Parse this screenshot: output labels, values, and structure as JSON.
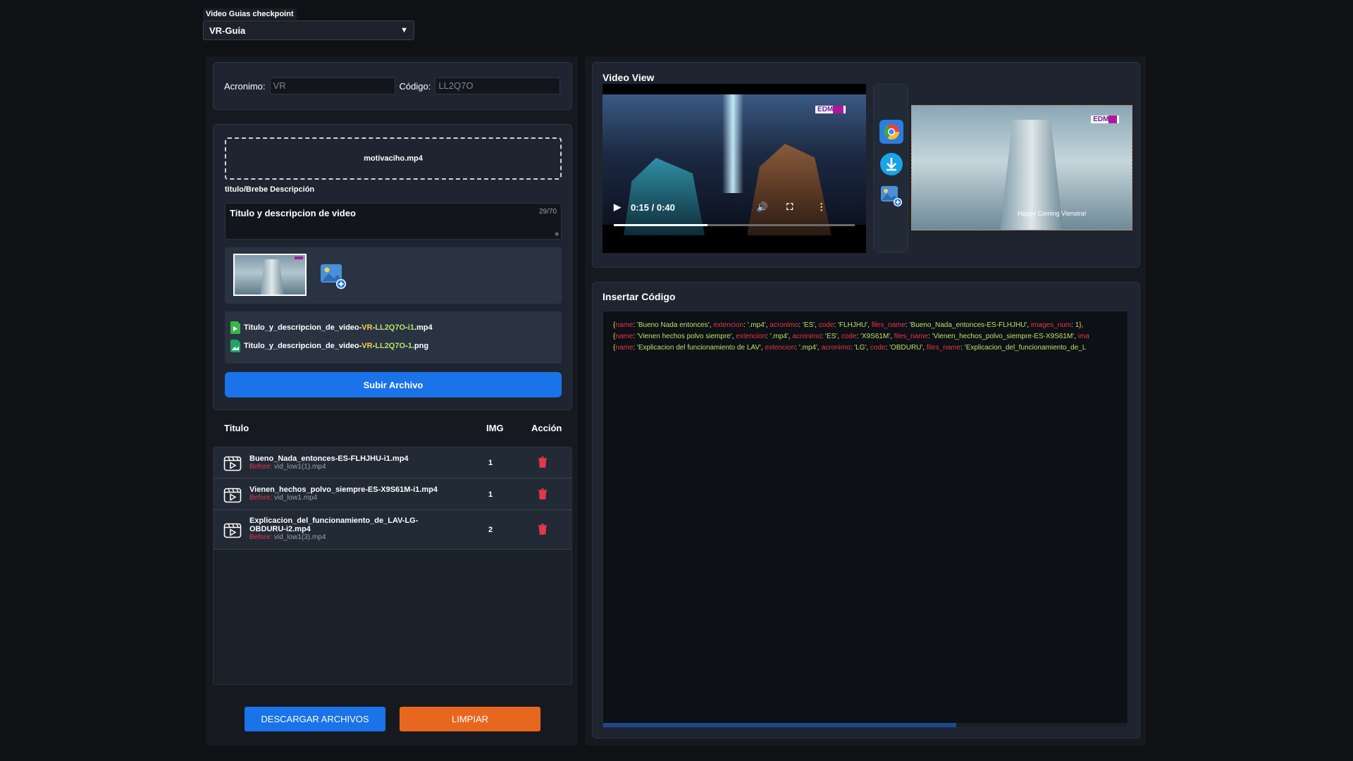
{
  "header": {
    "select_label": "Video Guias checkpoint",
    "select_value": "VR-Guia"
  },
  "form": {
    "acronimo_label": "Acronimo:",
    "acronimo_value": "VR",
    "codigo_label": "Código:",
    "codigo_value": "LL2Q7O"
  },
  "upload": {
    "file_name": "motivaciho.mp4",
    "desc_label": "titulo/Brebe Descripción",
    "desc_value": "Titulo y descripcion de video",
    "char_count": "29/70",
    "files": [
      {
        "base": "Titulo_y_descripcion_de_video-",
        "acr": "VR",
        "sep": "-",
        "code": "LL2Q7O",
        "suffix_sep": "-",
        "suffix": "i1",
        "ext": ".mp4",
        "type": "video"
      },
      {
        "base": "Titulo_y_descripcion_de_video-",
        "acr": "VR",
        "sep": "-",
        "code": "LL2Q7O",
        "suffix_sep": "-",
        "suffix": "1",
        "ext": ".png",
        "type": "image"
      }
    ],
    "submit_label": "Subir Archivo"
  },
  "table": {
    "headers": {
      "titulo": "Titulo",
      "img": "IMG",
      "accion": "Acción"
    },
    "before_label": "Before:",
    "rows": [
      {
        "name": "Bueno_Nada_entonces-ES-FLHJHU-i1.mp4",
        "before": "vid_low1(1).mp4",
        "img": "1"
      },
      {
        "name": "Vienen_hechos_polvo_siempre-ES-X9S61M-i1.mp4",
        "before": "vid_low1.mp4",
        "img": "1"
      },
      {
        "name": "Explicacion_del_funcionamiento_de_LAV-LG-OBDURU-i2.mp4",
        "before": "vid_low1(3).mp4",
        "img": "2"
      }
    ]
  },
  "actions": {
    "download_label": "DESCARGAR ARCHIVOS",
    "clear_label": "LIMPIAR"
  },
  "video": {
    "title": "Video View",
    "time": "0:15 / 0:40",
    "progress": 0.39,
    "logo_text": "EDM",
    "still_caption": "Happy Coming Vienstra!"
  },
  "code": {
    "title": "Insertar Código",
    "lines": [
      [
        [
          "p",
          "{"
        ],
        [
          "k",
          "name"
        ],
        [
          "w",
          ": "
        ],
        [
          "v",
          "'Bueno Nada entonces'"
        ],
        [
          "w",
          ", "
        ],
        [
          "k",
          "extencion"
        ],
        [
          "w",
          ": "
        ],
        [
          "v",
          "'.mp4'"
        ],
        [
          "w",
          ", "
        ],
        [
          "k",
          "acronimo"
        ],
        [
          "w",
          ": "
        ],
        [
          "v",
          "'ES'"
        ],
        [
          "w",
          ", "
        ],
        [
          "k",
          "code"
        ],
        [
          "w",
          ": "
        ],
        [
          "v",
          "'FLHJHU'"
        ],
        [
          "w",
          ", "
        ],
        [
          "k",
          "files_name"
        ],
        [
          "w",
          ": "
        ],
        [
          "v",
          "'Bueno_Nada_entonces-ES-FLHJHU'"
        ],
        [
          "w",
          ", "
        ],
        [
          "k",
          "images_num"
        ],
        [
          "w",
          ": "
        ],
        [
          "v",
          "1"
        ],
        [
          "p",
          "},"
        ]
      ],
      [
        [
          "p",
          "{"
        ],
        [
          "k",
          "name"
        ],
        [
          "w",
          ": "
        ],
        [
          "v",
          "'Vienen hechos polvo siempre'"
        ],
        [
          "w",
          ", "
        ],
        [
          "k",
          "extencion"
        ],
        [
          "w",
          ": "
        ],
        [
          "v",
          "'.mp4'"
        ],
        [
          "w",
          ", "
        ],
        [
          "k",
          "acronimo"
        ],
        [
          "w",
          ": "
        ],
        [
          "v",
          "'ES'"
        ],
        [
          "w",
          ", "
        ],
        [
          "k",
          "code"
        ],
        [
          "w",
          ": "
        ],
        [
          "v",
          "'X9S61M'"
        ],
        [
          "w",
          ", "
        ],
        [
          "k",
          "files_name"
        ],
        [
          "w",
          ": "
        ],
        [
          "v",
          "'Vienen_hechos_polvo_siempre-ES-X9S61M'"
        ],
        [
          "w",
          ", "
        ],
        [
          "k",
          "ima"
        ]
      ],
      [
        [
          "p",
          "{"
        ],
        [
          "k",
          "name"
        ],
        [
          "w",
          ": "
        ],
        [
          "v",
          "'Explicacion del funcionamiento de LAV'"
        ],
        [
          "w",
          ", "
        ],
        [
          "k",
          "extencion"
        ],
        [
          "w",
          ": "
        ],
        [
          "v",
          "'.mp4'"
        ],
        [
          "w",
          ", "
        ],
        [
          "k",
          "acronimo"
        ],
        [
          "w",
          ": "
        ],
        [
          "v",
          "'LG'"
        ],
        [
          "w",
          ", "
        ],
        [
          "k",
          "code"
        ],
        [
          "w",
          ": "
        ],
        [
          "v",
          "'OBDURU'"
        ],
        [
          "w",
          ", "
        ],
        [
          "k",
          "files_name"
        ],
        [
          "w",
          ": "
        ],
        [
          "v",
          "'Explicacion_del_funcionamiento_de_L"
        ]
      ]
    ]
  },
  "colors": {
    "accent_blue": "#1a73e8",
    "accent_orange": "#e8671f",
    "delete_red": "#e5364f",
    "code_value_green": "#b7e36a"
  },
  "icons": [
    "chevron-down-icon",
    "add-image-icon",
    "video-file-icon",
    "image-file-icon",
    "video-icon",
    "trash-icon",
    "play-icon",
    "volume-icon",
    "fullscreen-icon",
    "more-icon",
    "chrome-icon",
    "download-icon"
  ]
}
